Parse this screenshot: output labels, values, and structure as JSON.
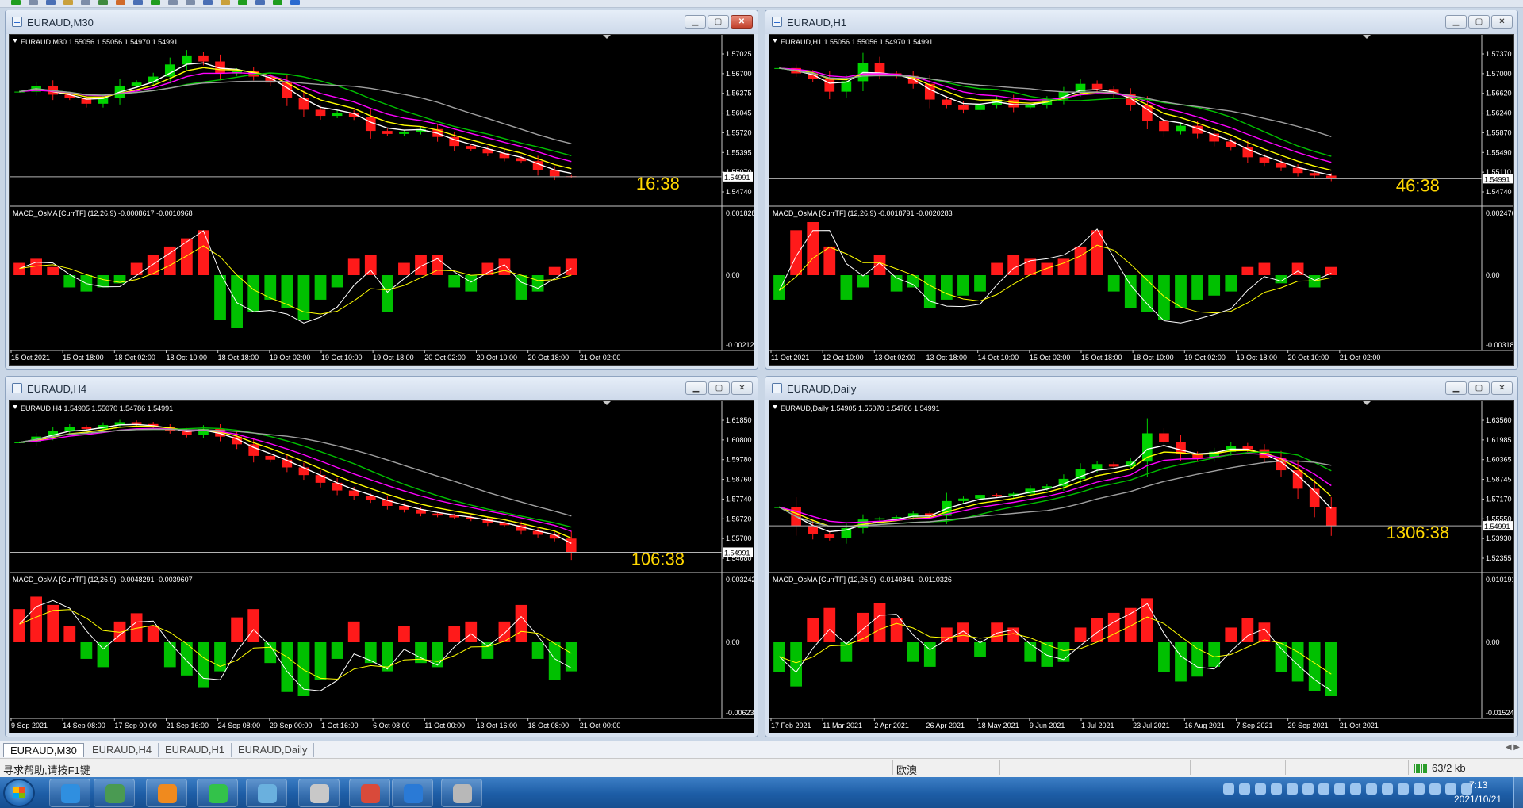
{
  "app": {
    "toolbar_icon_colors": [
      "#1f9d1f",
      "#7d8da8",
      "#4a6fb5",
      "#c9a03c",
      "#7d8da8",
      "#3f8a3f",
      "#d06a2a",
      "#4a6fb5",
      "#1f9d1f",
      "#7d8da8",
      "#7d8da8",
      "#4a6fb5",
      "#c9a03c",
      "#1f9d1f",
      "#4a6fb5",
      "#1f9d1f",
      "#2a6ad0"
    ]
  },
  "colors": {
    "bg": "#000000",
    "bull": "#00d400",
    "bear": "#ff1a1a",
    "ema_fast": "#ffffff",
    "ema_yellow": "#ffff00",
    "ema_magenta": "#ff00ff",
    "ema_green": "#00c000",
    "ema_gray": "#a0a0a0",
    "hist_up": "#ff1a1a",
    "hist_down": "#00c000",
    "macd": "#ffffff",
    "signal": "#ffff00",
    "axis_text": "#ffffff",
    "timer": "#ffd700"
  },
  "charts": [
    {
      "title": "EURAUD,M30",
      "info": "EURAUD,M30  1.55056 1.55056 1.54970 1.54991",
      "timer": "16:38",
      "price_label": "1.54991",
      "price_line": 1.54991,
      "price_ticks": [
        "1.57025",
        "1.56700",
        "1.56375",
        "1.56045",
        "1.55720",
        "1.55395",
        "1.55070",
        "1.54740"
      ],
      "macd_label": "MACD_OsMA [CurrTF] (12,26,9) -0.0008617 -0.0010968",
      "macd_ticks": [
        "0.001828",
        "0.00",
        "-0.002124"
      ],
      "time_ticks": [
        "15 Oct 2021",
        "15 Oct 18:00",
        "18 Oct 02:00",
        "18 Oct 10:00",
        "18 Oct 18:00",
        "19 Oct 02:00",
        "19 Oct 10:00",
        "19 Oct 18:00",
        "20 Oct 02:00",
        "20 Oct 10:00",
        "20 Oct 18:00",
        "21 Oct 02:00"
      ],
      "close": [
        1.564,
        1.565,
        1.5635,
        1.563,
        1.562,
        1.563,
        1.565,
        1.5655,
        1.5665,
        1.5685,
        1.57,
        1.569,
        1.567,
        1.5675,
        1.5665,
        1.5655,
        1.563,
        1.561,
        1.56,
        1.5605,
        1.5598,
        1.5575,
        1.557,
        1.5573,
        1.5578,
        1.5565,
        1.555,
        1.5545,
        1.5538,
        1.553,
        1.5525,
        1.551,
        1.55,
        1.5499
      ],
      "hist": [
        0.3,
        0.4,
        0.2,
        -0.3,
        -0.4,
        -0.3,
        -0.2,
        0.3,
        0.5,
        0.7,
        0.9,
        1.1,
        -1.1,
        -1.3,
        -0.9,
        -0.6,
        -0.8,
        -1.1,
        -0.6,
        -0.3,
        0.4,
        0.5,
        -0.9,
        0.3,
        0.5,
        0.5,
        -0.3,
        -0.4,
        0.3,
        0.4,
        -0.6,
        -0.4,
        0.2,
        0.4
      ]
    },
    {
      "title": "EURAUD,H1",
      "info": "EURAUD,H1  1.55056 1.55056 1.54970 1.54991",
      "timer": "46:38",
      "price_label": "1.54991",
      "price_line": 1.54991,
      "price_ticks": [
        "1.57370",
        "1.57000",
        "1.56620",
        "1.56240",
        "1.55870",
        "1.55490",
        "1.55110",
        "1.54740"
      ],
      "macd_label": "MACD_OsMA [CurrTF] (12,26,9) -0.0018791 -0.0020283",
      "macd_ticks": [
        "0.0024762",
        "0.00",
        "-0.003183"
      ],
      "time_ticks": [
        "11 Oct 2021",
        "12 Oct 10:00",
        "13 Oct 02:00",
        "13 Oct 18:00",
        "14 Oct 10:00",
        "15 Oct 02:00",
        "15 Oct 18:00",
        "18 Oct 10:00",
        "19 Oct 02:00",
        "19 Oct 18:00",
        "20 Oct 10:00",
        "21 Oct 02:00"
      ],
      "close": [
        1.571,
        1.57,
        1.569,
        1.5665,
        1.5685,
        1.572,
        1.57,
        1.5695,
        1.568,
        1.565,
        1.564,
        1.563,
        1.564,
        1.565,
        1.5635,
        1.564,
        1.565,
        1.5665,
        1.568,
        1.567,
        1.566,
        1.564,
        1.561,
        1.559,
        1.56,
        1.5585,
        1.557,
        1.556,
        1.554,
        1.553,
        1.552,
        1.551,
        1.5505,
        1.5499
      ],
      "hist": [
        -0.6,
        1.1,
        1.3,
        0.7,
        -0.6,
        -0.3,
        0.5,
        -0.4,
        -0.3,
        -0.8,
        -0.6,
        -0.5,
        -0.4,
        0.3,
        0.5,
        0.4,
        0.3,
        0.4,
        0.7,
        1.1,
        -0.4,
        -0.8,
        -0.9,
        -1.1,
        -0.8,
        -0.6,
        -0.5,
        -0.4,
        0.2,
        0.3,
        -0.2,
        0.3,
        -0.3,
        0.2
      ]
    },
    {
      "title": "EURAUD,H4",
      "info": "EURAUD,H4  1.54905 1.55070 1.54786 1.54991",
      "timer": "106:38",
      "price_label": "1.54991",
      "price_line": 1.54991,
      "price_ticks": [
        "1.61850",
        "1.60800",
        "1.59780",
        "1.58760",
        "1.57740",
        "1.56720",
        "1.55700",
        "1.54680"
      ],
      "macd_label": "MACD_OsMA [CurrTF] (12,26,9) -0.0048291 -0.0039607",
      "macd_ticks": [
        "0.0032424",
        "0.00",
        "-0.006238"
      ],
      "time_ticks": [
        "9 Sep 2021",
        "14 Sep 08:00",
        "17 Sep 00:00",
        "21 Sep 16:00",
        "24 Sep 08:00",
        "29 Sep 00:00",
        "1 Oct 16:00",
        "6 Oct 08:00",
        "11 Oct 00:00",
        "13 Oct 16:00",
        "18 Oct 08:00",
        "21 Oct 00:00"
      ],
      "close": [
        1.607,
        1.61,
        1.613,
        1.615,
        1.614,
        1.616,
        1.6175,
        1.6165,
        1.615,
        1.613,
        1.611,
        1.614,
        1.61,
        1.606,
        1.6,
        1.598,
        1.594,
        1.59,
        1.586,
        1.582,
        1.579,
        1.577,
        1.574,
        1.572,
        1.57,
        1.569,
        1.568,
        1.567,
        1.565,
        1.564,
        1.561,
        1.559,
        1.557,
        1.5499
      ],
      "hist": [
        0.8,
        1.1,
        0.9,
        0.4,
        -0.4,
        -0.6,
        0.5,
        0.7,
        0.4,
        -0.6,
        -0.8,
        -1.1,
        -0.7,
        0.6,
        0.8,
        -0.5,
        -1.2,
        -1.3,
        -0.9,
        -0.4,
        0.5,
        -0.5,
        -0.7,
        0.4,
        -0.5,
        -0.6,
        0.4,
        0.5,
        -0.4,
        0.5,
        0.9,
        -0.4,
        -0.9,
        -0.7
      ]
    },
    {
      "title": "EURAUD,Daily",
      "info": "EURAUD,Daily  1.54905 1.55070 1.54786 1.54991",
      "timer": "1306:38",
      "price_label": "1.54991",
      "price_line": 1.54991,
      "price_ticks": [
        "1.63560",
        "1.61985",
        "1.60365",
        "1.58745",
        "1.57170",
        "1.55550",
        "1.53930",
        "1.52355"
      ],
      "macd_label": "MACD_OsMA [CurrTF] (12,26,9) -0.0140841 -0.0110326",
      "macd_ticks": [
        "0.0101914",
        "0.00",
        "-0.01524"
      ],
      "time_ticks": [
        "17 Feb 2021",
        "11 Mar 2021",
        "2 Apr 2021",
        "26 Apr 2021",
        "18 May 2021",
        "9 Jun 2021",
        "1 Jul 2021",
        "23 Jul 2021",
        "16 Aug 2021",
        "7 Sep 2021",
        "29 Sep 2021",
        "21 Oct 2021"
      ],
      "close": [
        1.565,
        1.55,
        1.543,
        1.54,
        1.548,
        1.555,
        1.556,
        1.557,
        1.56,
        1.558,
        1.57,
        1.572,
        1.575,
        1.574,
        1.576,
        1.58,
        1.582,
        1.588,
        1.596,
        1.6,
        1.598,
        1.602,
        1.625,
        1.618,
        1.608,
        1.605,
        1.61,
        1.615,
        1.612,
        1.605,
        1.595,
        1.58,
        1.565,
        1.5499
      ],
      "hist": [
        -0.6,
        -0.9,
        0.5,
        0.7,
        -0.4,
        0.6,
        0.8,
        0.5,
        -0.4,
        -0.5,
        0.3,
        0.4,
        -0.3,
        0.4,
        0.3,
        -0.4,
        -0.5,
        -0.4,
        0.3,
        0.5,
        0.6,
        0.7,
        0.9,
        -0.6,
        -0.8,
        -0.7,
        -0.5,
        0.3,
        0.5,
        0.4,
        -0.6,
        -0.8,
        -1.0,
        -1.1
      ]
    }
  ],
  "tabs": [
    "EURAUD,M30",
    "EURAUD,H4",
    "EURAUD,H1",
    "EURAUD,Daily"
  ],
  "status": {
    "help": "寻求帮助,请按F1键",
    "profile": "欧澳",
    "traffic": "63/2 kb"
  },
  "taskbar": {
    "time": "7:13",
    "date": "2021/10/21",
    "apps": [
      {
        "name": "desktop-app",
        "color": "#2f8fe0"
      },
      {
        "name": "network-app",
        "color": "#4a9a52"
      },
      {
        "name": "orange-app",
        "color": "#f08a1e"
      },
      {
        "name": "wechat-app",
        "color": "#33c24a"
      },
      {
        "name": "notes-app",
        "color": "#6ab0de"
      },
      {
        "name": "archive-app",
        "color": "#c8c8c8"
      },
      {
        "name": "paint-app",
        "color": "#d94a3a"
      },
      {
        "name": "pen-app",
        "color": "#2a7ad6"
      },
      {
        "name": "terminal-app",
        "color": "#b8b8b8"
      }
    ]
  }
}
